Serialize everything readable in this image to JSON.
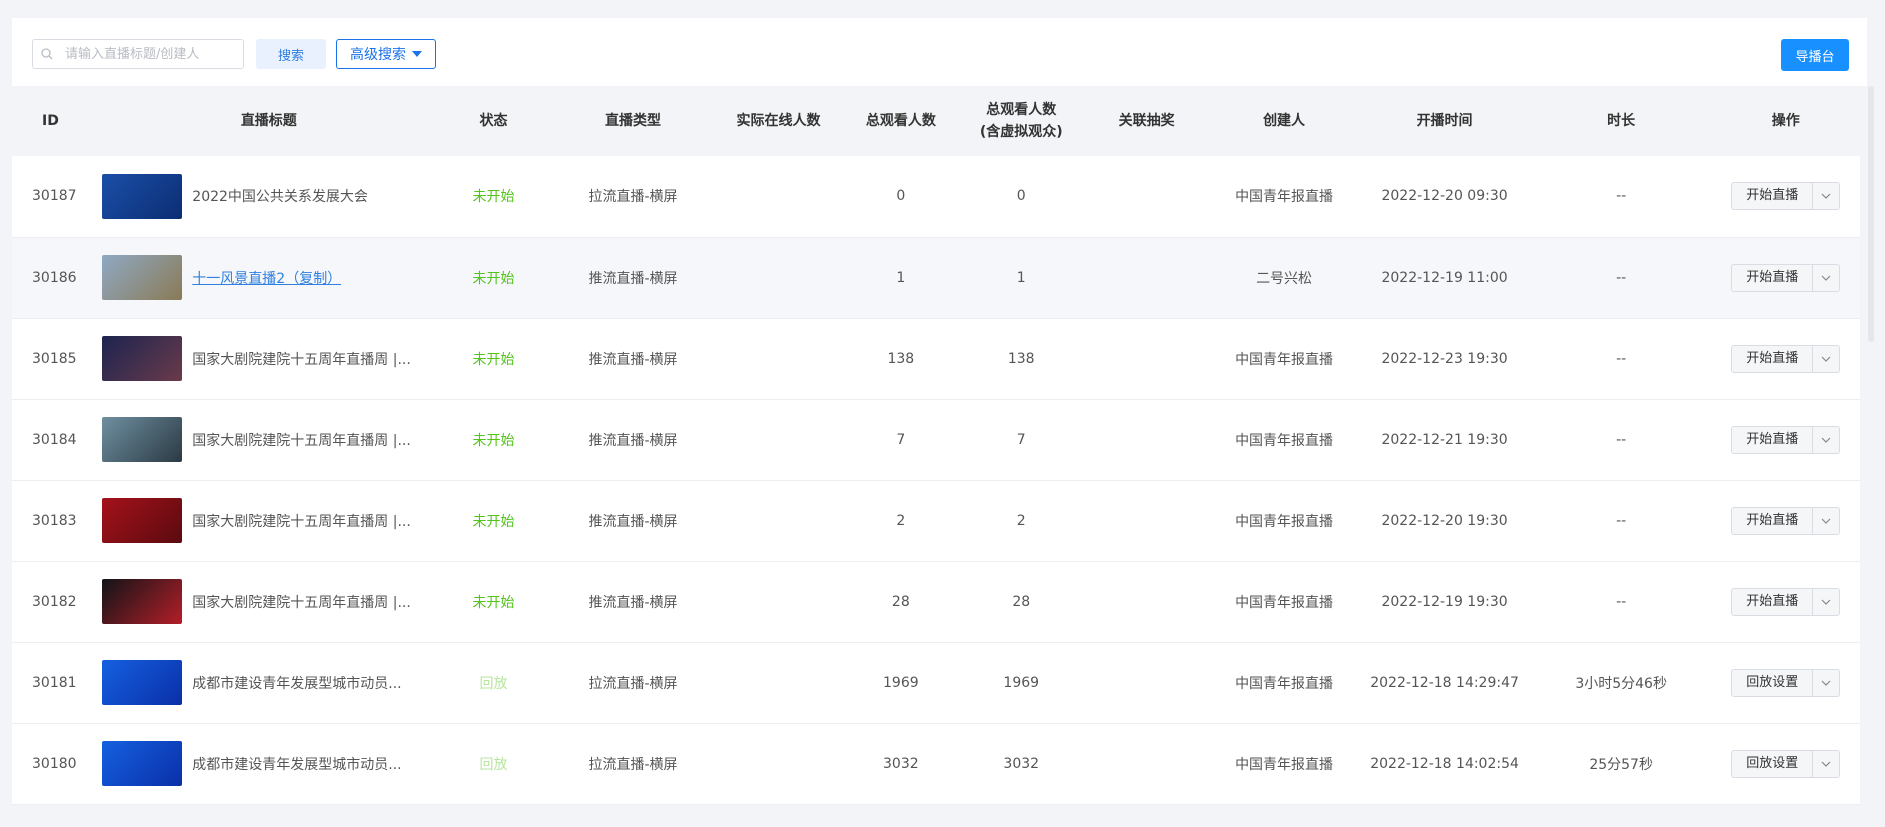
{
  "toolbar": {
    "search_placeholder": "请输入直播标题/创建人",
    "search_label": "搜索",
    "advanced_label": "高级搜索",
    "director_label": "导播台"
  },
  "columns": {
    "id": "ID",
    "title": "直播标题",
    "status": "状态",
    "type": "直播类型",
    "online": "实际在线人数",
    "viewers": "总观看人数",
    "viewers_virtual_line1": "总观看人数",
    "viewers_virtual_line2": "(含虚拟观众)",
    "lottery": "关联抽奖",
    "creator": "创建人",
    "start_time": "开播时间",
    "duration": "时长",
    "action": "操作"
  },
  "rows": [
    {
      "id": "30187",
      "title": "2022中国公共关系发展大会",
      "status": "未开始",
      "type": "拉流直播-横屏",
      "online": "",
      "viewers": "0",
      "viewers_virtual": "0",
      "lottery": "",
      "creator": "中国青年报直播",
      "start_time": "2022-12-20 09:30",
      "duration": "--",
      "action": "开始直播",
      "thumb_colors": [
        "#1a4fa8",
        "#0c2d73"
      ]
    },
    {
      "id": "30186",
      "title": "十一风景直播2（复制）",
      "status": "未开始",
      "type": "推流直播-横屏",
      "online": "",
      "viewers": "1",
      "viewers_virtual": "1",
      "lottery": "",
      "creator": "二号兴松",
      "start_time": "2022-12-19 11:00",
      "duration": "--",
      "action": "开始直播",
      "thumb_colors": [
        "#8fa9c4",
        "#8a7a55"
      ]
    },
    {
      "id": "30185",
      "title": "国家大剧院建院十五周年直播周 |...",
      "status": "未开始",
      "type": "推流直播-横屏",
      "online": "",
      "viewers": "138",
      "viewers_virtual": "138",
      "lottery": "",
      "creator": "中国青年报直播",
      "start_time": "2022-12-23 19:30",
      "duration": "--",
      "action": "开始直播",
      "thumb_colors": [
        "#1c2450",
        "#6a3a4a"
      ]
    },
    {
      "id": "30184",
      "title": "国家大剧院建院十五周年直播周 |...",
      "status": "未开始",
      "type": "推流直播-横屏",
      "online": "",
      "viewers": "7",
      "viewers_virtual": "7",
      "lottery": "",
      "creator": "中国青年报直播",
      "start_time": "2022-12-21 19:30",
      "duration": "--",
      "action": "开始直播",
      "thumb_colors": [
        "#6e8fa0",
        "#2b3a44"
      ]
    },
    {
      "id": "30183",
      "title": "国家大剧院建院十五周年直播周 |...",
      "status": "未开始",
      "type": "推流直播-横屏",
      "online": "",
      "viewers": "2",
      "viewers_virtual": "2",
      "lottery": "",
      "creator": "中国青年报直播",
      "start_time": "2022-12-20 19:30",
      "duration": "--",
      "action": "开始直播",
      "thumb_colors": [
        "#a5121a",
        "#5a0a10"
      ]
    },
    {
      "id": "30182",
      "title": "国家大剧院建院十五周年直播周 |...",
      "status": "未开始",
      "type": "推流直播-横屏",
      "online": "",
      "viewers": "28",
      "viewers_virtual": "28",
      "lottery": "",
      "creator": "中国青年报直播",
      "start_time": "2022-12-19 19:30",
      "duration": "--",
      "action": "开始直播",
      "thumb_colors": [
        "#111418",
        "#b31e28"
      ]
    },
    {
      "id": "30181",
      "title": "成都市建设青年发展型城市动员...",
      "status": "回放",
      "type": "拉流直播-横屏",
      "online": "",
      "viewers": "1969",
      "viewers_virtual": "1969",
      "lottery": "",
      "creator": "中国青年报直播",
      "start_time": "2022-12-18 14:29:47",
      "duration": "3小时5分46秒",
      "action": "回放设置",
      "thumb_colors": [
        "#1560e0",
        "#0a2fa8"
      ]
    },
    {
      "id": "30180",
      "title": "成都市建设青年发展型城市动员...",
      "status": "回放",
      "type": "拉流直播-横屏",
      "online": "",
      "viewers": "3032",
      "viewers_virtual": "3032",
      "lottery": "",
      "creator": "中国青年报直播",
      "start_time": "2022-12-18 14:02:54",
      "duration": "25分57秒",
      "action": "回放设置",
      "thumb_colors": [
        "#1560e0",
        "#0a2fa8"
      ]
    }
  ],
  "colors": {
    "primary": "#1890ff",
    "status_not_started": "#52c41a",
    "status_replay": "#b7e5a0",
    "link": "#2f7fe0"
  },
  "icons": {
    "search": "search-icon",
    "caret": "caret-down-icon",
    "chevron": "chevron-down-icon"
  }
}
